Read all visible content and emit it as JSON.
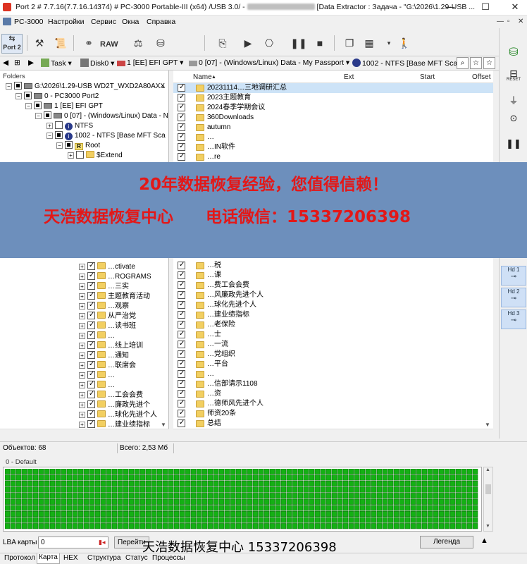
{
  "window": {
    "title": "Port 2 # 7.7.16(7.7.16.14374) # PC-3000 Portable-III (x64) /USB 3.0/ - ",
    "title_suffix": "[Data Extractor : Задача - \"G:\\2026\\1.29-USB ...",
    "minimize": "—",
    "maximize": "☐",
    "close": "✕"
  },
  "menu": {
    "items": [
      "PC-3000",
      "Настройки",
      "Сервис",
      "Окна",
      "Справка"
    ],
    "right": [
      "—",
      "▫",
      "✕"
    ]
  },
  "toolbar": {
    "port_label": "Port 2",
    "raw_label": "RAW"
  },
  "pathbar": {
    "task": "Task",
    "disk": "Disk0",
    "partition1": "1 [EE] EFI GPT",
    "partition2": "0 [07] - (Windows/Linux) Data - My Passport",
    "ntfs": "1002 - NTFS [Base MFT Scar"
  },
  "folders": {
    "header": "Folders",
    "tree": [
      {
        "label": "G:\\2026\\1.29-USB WD2T_WXD2A80AXX",
        "kind": "drive",
        "exp": "−",
        "check": "partial"
      },
      {
        "label": "0 - PC3000 Port2",
        "kind": "drive",
        "exp": "−",
        "check": "partial"
      },
      {
        "label": "1 [EE] EFI GPT",
        "kind": "drive",
        "exp": "−",
        "check": "partial"
      },
      {
        "label": "0 [07] - (Windows/Linux) Data - N",
        "kind": "drive",
        "exp": "−",
        "check": "partial"
      },
      {
        "label": "NTFS",
        "kind": "ntfs",
        "exp": "+",
        "check": "none"
      },
      {
        "label": "1002 - NTFS [Base MFT Sca",
        "kind": "ntfs",
        "exp": "−",
        "check": "partial"
      },
      {
        "label": "Root",
        "kind": "root",
        "exp": "−",
        "check": "partial"
      },
      {
        "label": "$Extend",
        "kind": "folder",
        "exp": "+",
        "check": "none"
      }
    ],
    "tree_lower": [
      "…ctivate",
      "…ROGRAMS",
      "…三实",
      "主题教育活动",
      "…观察",
      "从严治党",
      "…读书班",
      "…",
      "…线上培训",
      "…通知",
      "…联席会",
      "…",
      "…",
      "…工会会费",
      "…廉政先进个",
      "…球化先进个人",
      "…建业绩指标",
      "…老保险"
    ]
  },
  "filelist": {
    "columns": {
      "name": "Name",
      "ext": "Ext",
      "start": "Start",
      "offset": "Offset"
    },
    "rows_top": [
      "20231114…三地调研汇总",
      "2023主题教育",
      "2024春季学期会议",
      "360Downloads",
      "autumn",
      "…",
      "…IN软件",
      "…re"
    ],
    "rows_bottom": [
      "…税",
      "…课",
      "…费工会会费",
      "…风廉政先进个人",
      "…球化先进个人",
      "…建业绩指标",
      "…老保险",
      "…士",
      "…一流",
      "…党组织",
      "…平台",
      "…",
      "…信部请示1108",
      "…资",
      "…德师风先进个人",
      "师资20条",
      "总结"
    ]
  },
  "banner": {
    "line1": "20年数据恢复经验，您值得信赖！",
    "line2": "天浩数据恢复中心　　电话微信：15337206398"
  },
  "right_panel": {
    "reset": "RESET",
    "hd1": "Hd 1",
    "hd2": "Hd 2",
    "hd3": "Hd 3"
  },
  "status": {
    "objects": "Объектов: 68",
    "total": "Всего: 2,53 Мб"
  },
  "map": {
    "label": "0 - Default",
    "fill_color": "#14b014"
  },
  "bottom": {
    "lba_label": "LBA карты",
    "lba_value": "0",
    "goto": "Перейти",
    "legend": "Легенда",
    "watermark": "天浩数据恢复中心 15337206398"
  },
  "tabs": [
    "Протокол",
    "Карта",
    "HEX",
    "Структура",
    "Статус",
    "Процессы"
  ]
}
